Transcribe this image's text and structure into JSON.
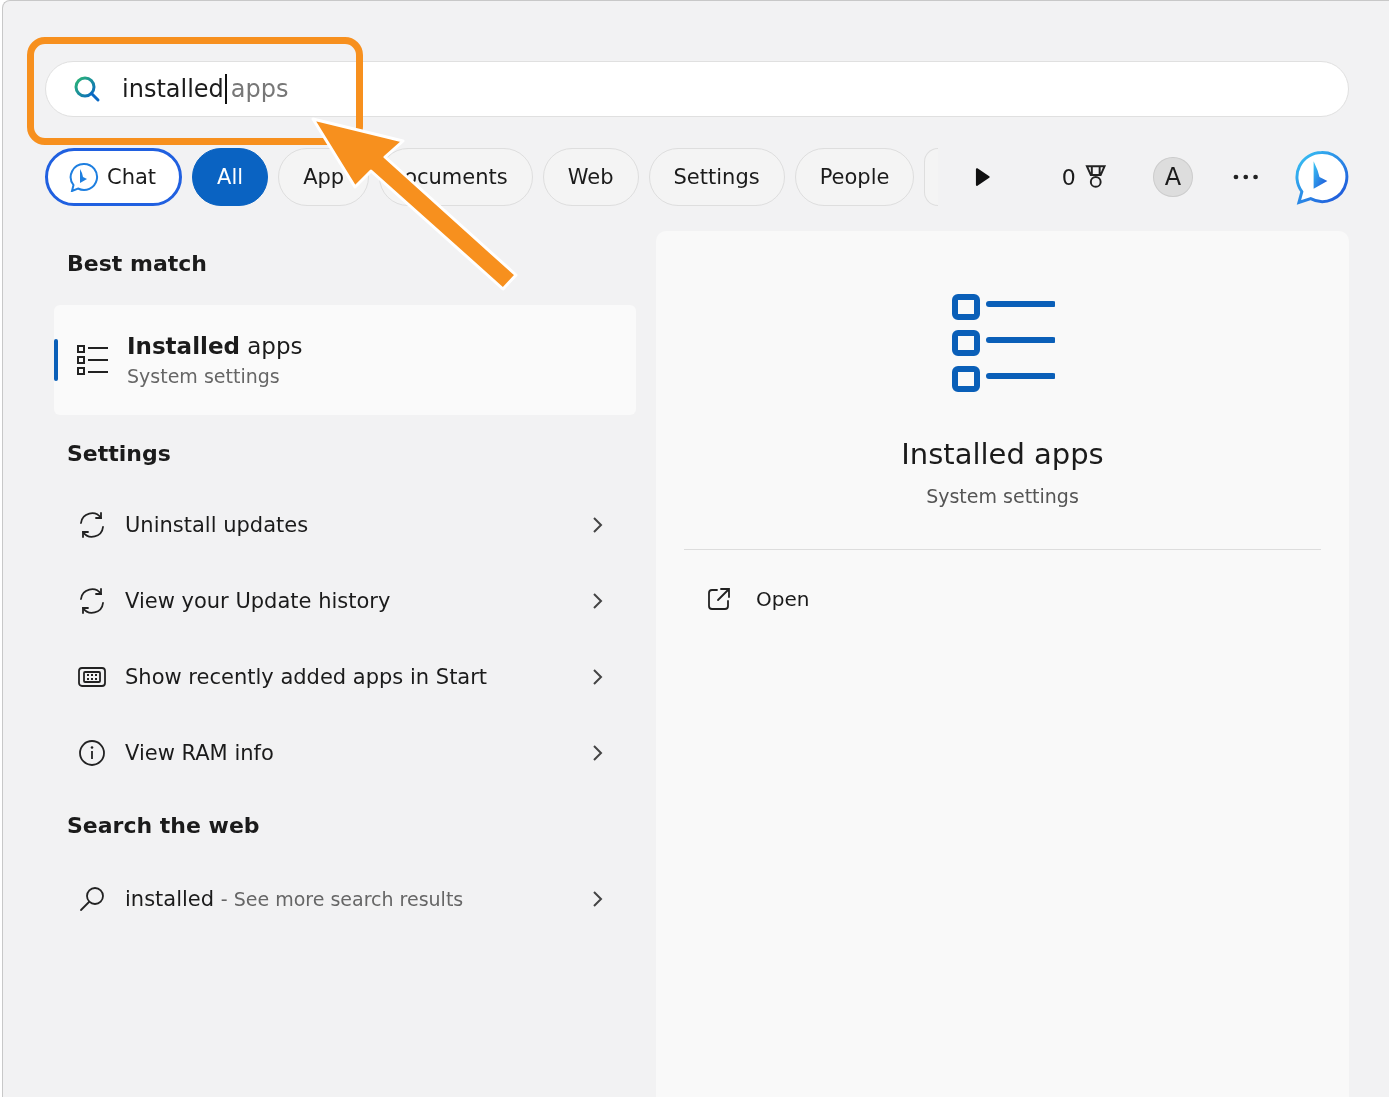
{
  "search": {
    "value": "installed",
    "suggestion": "apps"
  },
  "filters": [
    {
      "kind": "chat",
      "label": "Chat",
      "selected": false
    },
    {
      "kind": "pill",
      "label": "All",
      "selected": true
    },
    {
      "kind": "pill",
      "label": "App",
      "selected": false
    },
    {
      "kind": "pill",
      "label": "ocuments",
      "selected": false
    },
    {
      "kind": "pill",
      "label": "Web",
      "selected": false
    },
    {
      "kind": "pill",
      "label": "Settings",
      "selected": false
    },
    {
      "kind": "pill",
      "label": "People",
      "selected": false
    }
  ],
  "toolbar": {
    "points": "0",
    "avatar": "A"
  },
  "best_match": {
    "heading": "Best match",
    "title_bold": "Installed",
    "title_rest": "apps",
    "subtitle": "System settings",
    "selected": true
  },
  "settings": {
    "heading": "Settings",
    "items": [
      {
        "kind": "sync",
        "label": "Uninstall updates"
      },
      {
        "kind": "sync",
        "label": "View your Update history"
      },
      {
        "kind": "keyboard",
        "label": "Show recently added apps in Start"
      },
      {
        "kind": "info",
        "label": "View RAM info"
      }
    ]
  },
  "web": {
    "heading": "Search the web",
    "query": "installed",
    "hint": "- See more search results"
  },
  "preview": {
    "title": "Installed apps",
    "subtitle": "System settings",
    "actions": [
      {
        "label": "Open"
      }
    ]
  }
}
